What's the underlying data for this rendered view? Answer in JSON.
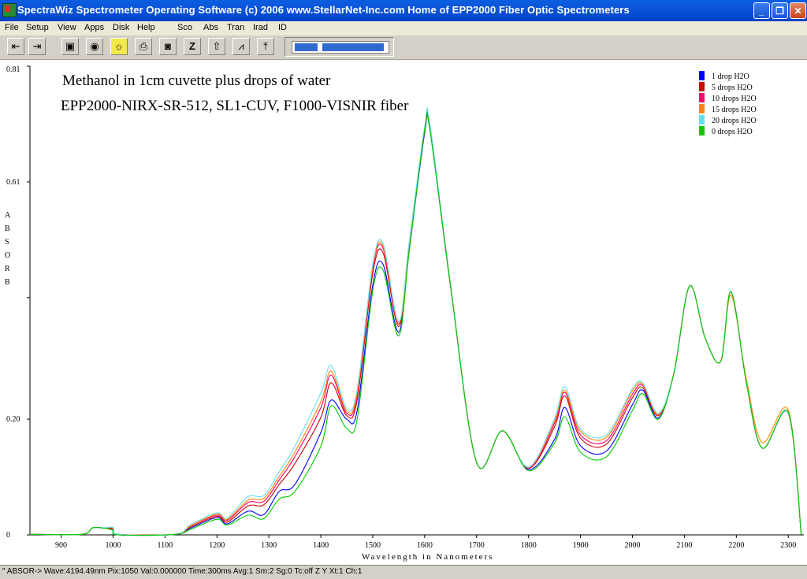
{
  "window": {
    "title": "SpectraWiz  Spectrometer Operating Software (c) 2006  www.StellarNet-Inc.com  Home of EPP2000 Fiber Optic Spectrometers",
    "icon": "spectrawiz-app-icon",
    "controls": {
      "minimize": "_",
      "maximize": "❐",
      "close": "✕"
    }
  },
  "menu": [
    "File",
    "Setup",
    "View",
    "Apps",
    "Disk",
    "Help",
    "Sco",
    "Abs",
    "Tran",
    "Irad",
    "ID"
  ],
  "toolbar": {
    "buttons": [
      {
        "icon": "scroll-left-icon",
        "glyph": "⇤"
      },
      {
        "icon": "scroll-right-icon",
        "glyph": "⇥"
      },
      {
        "icon": "save-disk-icon",
        "glyph": "▣"
      },
      {
        "icon": "dark-bulb-icon",
        "glyph": "◉"
      },
      {
        "icon": "reference-bulb-icon",
        "glyph": "☼"
      },
      {
        "icon": "print-icon",
        "glyph": "⎙"
      },
      {
        "icon": "camera-icon",
        "glyph": "◙"
      },
      {
        "icon": "zoom-z-icon",
        "glyph": "Z"
      },
      {
        "icon": "rescale-up-icon",
        "glyph": "⇧"
      },
      {
        "icon": "peak-icon",
        "glyph": "⩘"
      },
      {
        "icon": "export-icon",
        "glyph": "⤒"
      }
    ],
    "progress_fraction": 1.0
  },
  "chart_data": {
    "type": "line",
    "title": "Methanol in 1cm cuvette plus drops of water",
    "subtitle": "EPP2000-NIRX-SR-512, SL1-CUV, F1000-VISNIR fiber",
    "xlabel": "Wavelength in Nanometers",
    "ylabel": "ABSORB",
    "xlim": [
      840,
      2330
    ],
    "ylim": [
      0,
      0.81
    ],
    "xticks": [
      900,
      1000,
      1100,
      1200,
      1300,
      1400,
      1500,
      1600,
      1700,
      1800,
      1900,
      2000,
      2100,
      2200,
      2300
    ],
    "yticks": [
      0,
      0.2,
      0.61,
      0.81
    ],
    "ytick_labels": [
      "0",
      "0.20",
      "0.61",
      "0.81"
    ],
    "legend_position": "top-right",
    "series": [
      {
        "name": "1 drop H2O",
        "color": "#0000ff",
        "dy": [
          0,
          0,
          0,
          0,
          0.001,
          -0.001,
          0,
          0,
          0.002,
          -0.001,
          0.003,
          -0.003,
          0.01,
          -0.008,
          0.022,
          -0.025,
          0.01,
          0.01,
          -0.008,
          -0.008,
          -0.008,
          -0.01,
          -0.015,
          0.01,
          -0.002,
          0,
          0,
          -0.002,
          -0.01,
          0.01,
          -0.001,
          0,
          0,
          0,
          -0.008,
          0,
          0,
          0,
          0,
          0,
          0,
          0,
          0,
          0
        ]
      },
      {
        "name": "5 drops H2O",
        "color": "#cc0000",
        "dy": [
          0,
          0,
          0,
          0,
          0.002,
          0,
          0,
          0.002,
          0.004,
          0.002,
          0.012,
          0.014,
          0.022,
          0.028,
          0.048,
          0.005,
          0.016,
          0.028,
          0.012,
          0.012,
          0.002,
          -0.004,
          -0.01,
          0.014,
          -0.001,
          0,
          0,
          0,
          0.012,
          0.03,
          0.012,
          0.012,
          0.012,
          0.004,
          -0.004,
          0,
          0,
          0,
          0,
          0,
          0,
          0,
          0,
          0
        ]
      },
      {
        "name": "10 drops H2O",
        "color": "#ff0066",
        "dy": [
          0,
          0,
          0,
          0,
          0.003,
          0,
          0,
          0.004,
          0.006,
          0.005,
          0.018,
          0.02,
          0.03,
          0.04,
          0.065,
          0.018,
          0.02,
          0.036,
          0.02,
          0.02,
          0.006,
          0.002,
          -0.012,
          0.016,
          0,
          0,
          0,
          0,
          0.018,
          0.036,
          0.018,
          0.018,
          0.018,
          0.008,
          -0.002,
          0,
          0,
          0,
          0,
          0,
          0,
          0,
          0,
          0
        ]
      },
      {
        "name": "15 drops H2O",
        "color": "#ff8800",
        "dy": [
          0,
          0,
          0,
          0,
          0.004,
          0,
          0,
          0.004,
          0.008,
          0.007,
          0.022,
          0.025,
          0.036,
          0.048,
          0.075,
          0.025,
          0.024,
          0.04,
          0.024,
          0.024,
          0.008,
          0.003,
          -0.008,
          0.018,
          0,
          0,
          0,
          0.002,
          0.022,
          0.04,
          0.024,
          0.024,
          0.024,
          0.01,
          -0.002,
          0,
          0,
          0,
          0,
          -0.006,
          0.006,
          0.01,
          0.006,
          0
        ]
      },
      {
        "name": "20 drops H2O",
        "color": "#66e0ee",
        "dy": [
          0,
          0,
          0,
          0,
          0.005,
          0,
          0,
          0.006,
          0.01,
          0.009,
          0.028,
          0.03,
          0.044,
          0.058,
          0.09,
          0.035,
          0.028,
          0.046,
          0.028,
          0.028,
          0.01,
          0.004,
          -0.005,
          0.02,
          0,
          0,
          0,
          0.002,
          0.026,
          0.046,
          0.028,
          0.028,
          0.028,
          0.012,
          0,
          0,
          0,
          0,
          0,
          0,
          0,
          0,
          0,
          0
        ]
      },
      {
        "name": "0 drops H2O",
        "color": "#00cc00",
        "dy": [
          0,
          0,
          0,
          0,
          0,
          -0.002,
          0,
          -0.002,
          -0.001,
          -0.003,
          -0.004,
          -0.01,
          -0.003,
          -0.02,
          -0.002,
          -0.035,
          -0.006,
          -0.005,
          -0.018,
          -0.018,
          -0.014,
          -0.012,
          -0.01,
          0.01,
          0,
          0,
          0,
          -0.004,
          -0.016,
          -0.006,
          -0.012,
          -0.01,
          -0.01,
          -0.006,
          -0.01,
          0,
          0,
          0,
          0,
          0,
          0,
          0,
          0.002,
          0
        ]
      }
    ],
    "base_x": [
      840,
      940,
      960,
      980,
      1000,
      1010,
      1120,
      1150,
      1200,
      1220,
      1260,
      1290,
      1320,
      1350,
      1400,
      1420,
      1450,
      1470,
      1500,
      1520,
      1550,
      1570,
      1600,
      1610,
      1650,
      1700,
      1750,
      1800,
      1850,
      1870,
      1900,
      1950,
      2000,
      2020,
      2050,
      2080,
      2110,
      2140,
      2170,
      2190,
      2220,
      2250,
      2300,
      2325
    ],
    "base_y": [
      0.001,
      0.001,
      0.012,
      0.012,
      0.008,
      0.001,
      0.001,
      0.012,
      0.028,
      0.02,
      0.038,
      0.038,
      0.065,
      0.095,
      0.155,
      0.258,
      0.19,
      0.205,
      0.44,
      0.475,
      0.358,
      0.5,
      0.71,
      0.69,
      0.43,
      0.125,
      0.18,
      0.115,
      0.175,
      0.21,
      0.155,
      0.145,
      0.225,
      0.25,
      0.21,
      0.28,
      0.43,
      0.34,
      0.3,
      0.42,
      0.26,
      0.15,
      0.21,
      0.001
    ]
  },
  "status": "\" ABSOR->   Wave:4194.49nm  Pix:1050  Val:0.000000  Time:300ms  Avg:1  Sm:2  Sg:0  Tc:off  Z Y  Xt:1  Ch:1"
}
